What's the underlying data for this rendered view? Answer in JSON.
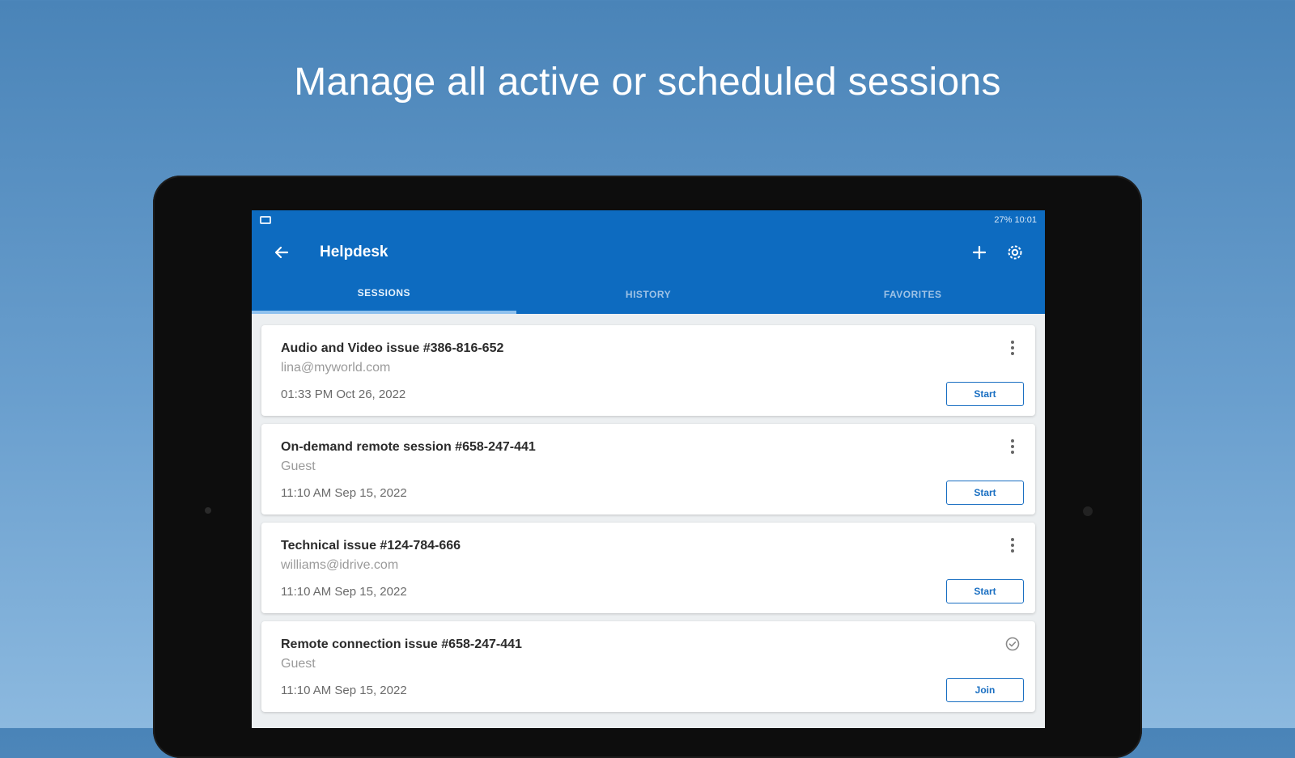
{
  "headline": "Manage all active or scheduled sessions",
  "statusbar": {
    "right": "27% 10:01"
  },
  "appbar": {
    "title": "Helpdesk",
    "back_icon": "arrow-left-icon",
    "add_icon": "plus-icon",
    "settings_icon": "gear-icon"
  },
  "tabs": [
    {
      "label": "SESSIONS",
      "active": true
    },
    {
      "label": "HISTORY",
      "active": false
    },
    {
      "label": "FAVORITES",
      "active": false
    }
  ],
  "sessions": [
    {
      "title": "Audio and Video issue #386-816-652",
      "subtitle": "lina@myworld.com",
      "time": "01:33 PM Oct 26, 2022",
      "action": "Start",
      "menu_icon": "more-vertical-icon"
    },
    {
      "title": "On-demand remote session #658-247-441",
      "subtitle": "Guest",
      "time": "11:10 AM Sep 15, 2022",
      "action": "Start",
      "menu_icon": "more-vertical-icon"
    },
    {
      "title": "Technical issue #124-784-666",
      "subtitle": "williams@idrive.com",
      "time": "11:10 AM Sep 15, 2022",
      "action": "Start",
      "menu_icon": "more-vertical-icon"
    },
    {
      "title": "Remote connection issue #658-247-441",
      "subtitle": "Guest",
      "time": "11:10 AM Sep 15, 2022",
      "action": "Join",
      "menu_icon": "check-circle-icon"
    }
  ],
  "colors": {
    "primary": "#0d6bc0",
    "accent": "#1a6fc2",
    "background": "#eceff1"
  }
}
